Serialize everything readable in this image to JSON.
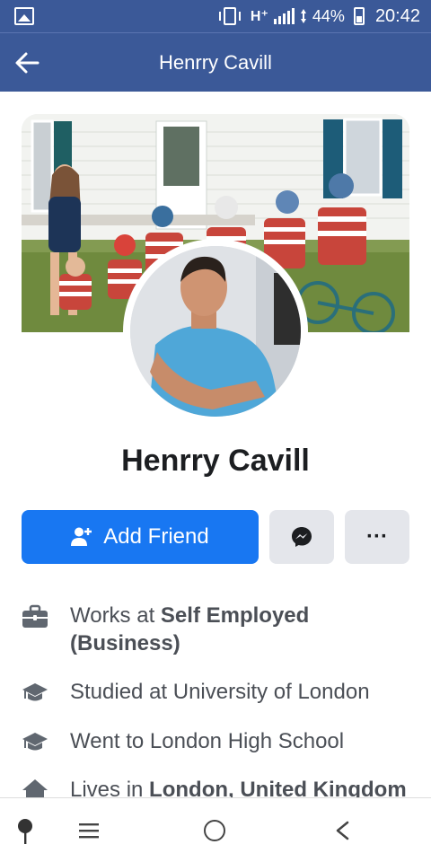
{
  "status_bar": {
    "network": "H⁺",
    "battery": "44%",
    "time": "20:42"
  },
  "header": {
    "title": "Henrry Cavill"
  },
  "profile": {
    "name": "Henrry Cavill"
  },
  "actions": {
    "add_friend_label": "Add Friend",
    "more_label": "···"
  },
  "info": [
    {
      "icon": "briefcase-icon",
      "prefix": "Works at ",
      "bold": "Self Employed (Business)"
    },
    {
      "icon": "graduation-cap-icon",
      "prefix": "Studied at University of London",
      "bold": ""
    },
    {
      "icon": "graduation-cap-icon",
      "prefix": "Went to London High School",
      "bold": ""
    },
    {
      "icon": "house-icon",
      "prefix": "Lives in ",
      "bold": "London, United Kingdom"
    }
  ],
  "colors": {
    "brand_bar": "#3b5998",
    "primary_button": "#1877f2",
    "secondary_button": "#e4e6eb"
  }
}
